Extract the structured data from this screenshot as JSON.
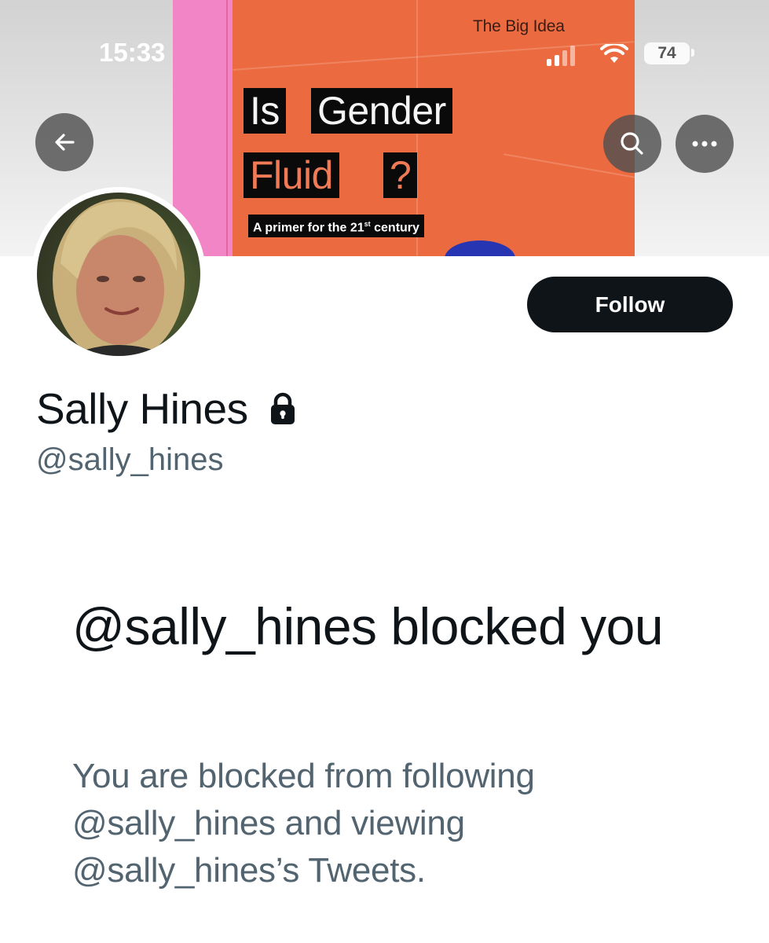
{
  "status_bar": {
    "time": "15:33",
    "battery": "74",
    "icons": [
      "signal-icon",
      "wifi-icon",
      "battery-icon"
    ]
  },
  "banner": {
    "series": "The Big Idea",
    "title_line1_a": "Is",
    "title_line1_b": "Gender",
    "title_line2_a": "Fluid",
    "title_line2_b": "?",
    "subtitle": "A primer for the 21",
    "subtitle_sup": "st",
    "subtitle_end": " century",
    "colors": {
      "book": "#ec6a3f",
      "spine": "#f185c6"
    }
  },
  "header": {
    "back_icon": "back-arrow-icon",
    "search_icon": "search-icon",
    "more_icon": "more-icon"
  },
  "profile": {
    "display_name": "Sally Hines",
    "handle": "@sally_hines",
    "protected_icon": "lock-icon",
    "follow_label": "Follow"
  },
  "blocked": {
    "title": "@sally_hines blocked you",
    "description": "You are blocked from following @sally_hines and viewing @sally_hines’s Tweets."
  },
  "colors": {
    "primary_text": "#0f1419",
    "secondary_text": "#536471",
    "button": "#0f1419"
  }
}
